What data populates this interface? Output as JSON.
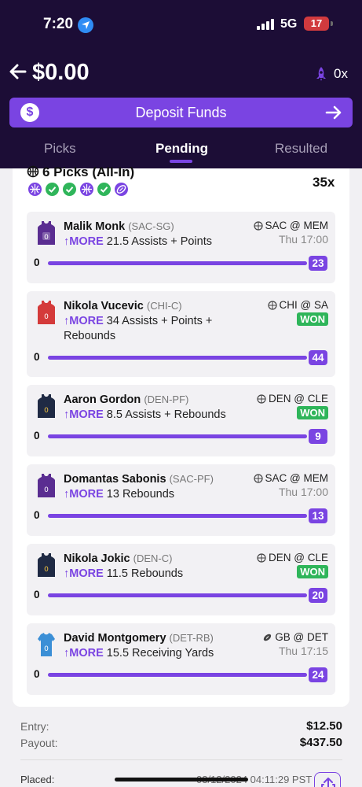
{
  "status_bar": {
    "time": "7:20",
    "network": "5G",
    "battery": "17"
  },
  "header": {
    "balance": "$0.00",
    "multiplier_badge": "0x",
    "deposit_label": "Deposit Funds",
    "coin_symbol": "$"
  },
  "tabs": [
    {
      "label": "Picks",
      "active": false
    },
    {
      "label": "Pending",
      "active": true
    },
    {
      "label": "Resulted",
      "active": false
    }
  ],
  "entry": {
    "title": "6 Picks (All-In)",
    "multiplier": "35x",
    "legs": [
      "basketball",
      "won",
      "won",
      "basketball",
      "won",
      "football"
    ]
  },
  "picks": [
    {
      "player": "Malik Monk",
      "pos": "(SAC-SG)",
      "direction": "MORE",
      "line": "21.5",
      "stat": "Assists + Points",
      "matchup": "SAC @ MEM",
      "time": "Thu 17:00",
      "won": false,
      "current": "23",
      "jersey_color": "#5a2d91",
      "sport": "basketball"
    },
    {
      "player": "Nikola Vucevic",
      "pos": "(CHI-C)",
      "direction": "MORE",
      "line": "34",
      "stat": "Assists + Points + Rebounds",
      "matchup": "CHI @ SA",
      "time": "",
      "won": true,
      "won_label": "WON",
      "current": "44",
      "jersey_color": "#d43a3a",
      "sport": "basketball"
    },
    {
      "player": "Aaron Gordon",
      "pos": "(DEN-PF)",
      "direction": "MORE",
      "line": "8.5",
      "stat": "Assists + Rebounds",
      "matchup": "DEN @ CLE",
      "time": "",
      "won": true,
      "won_label": "WON",
      "current": "9",
      "jersey_color": "#1f2a44",
      "sport": "basketball"
    },
    {
      "player": "Domantas Sabonis",
      "pos": "(SAC-PF)",
      "direction": "MORE",
      "line": "13",
      "stat": "Rebounds",
      "matchup": "SAC @ MEM",
      "time": "Thu 17:00",
      "won": false,
      "current": "13",
      "jersey_color": "#5a2d91",
      "sport": "basketball"
    },
    {
      "player": "Nikola Jokic",
      "pos": "(DEN-C)",
      "direction": "MORE",
      "line": "11.5",
      "stat": "Rebounds",
      "matchup": "DEN @ CLE",
      "time": "",
      "won": true,
      "won_label": "WON",
      "current": "20",
      "jersey_color": "#1f2a44",
      "sport": "basketball"
    },
    {
      "player": "David Montgomery",
      "pos": "(DET-RB)",
      "direction": "MORE",
      "line": "15.5",
      "stat": "Receiving Yards",
      "matchup": "GB @ DET",
      "time": "Thu 17:15",
      "won": false,
      "current": "24",
      "jersey_color": "#3b8fd6",
      "sport": "football"
    }
  ],
  "totals": {
    "entry_label": "Entry:",
    "entry_value": "$12.50",
    "payout_label": "Payout:",
    "payout_value": "$437.50"
  },
  "placed": {
    "label": "Placed:",
    "value": "03/12/2024 04:11:29 PST"
  },
  "colors": {
    "accent": "#7a44e2",
    "header_bg": "#1c0d36",
    "won": "#2fb55a"
  }
}
